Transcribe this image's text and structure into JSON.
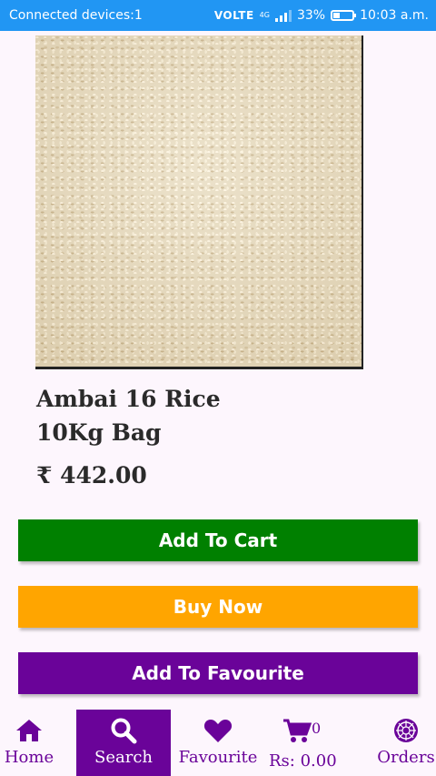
{
  "status_bar": {
    "left_text": "Connected devices:1",
    "network": "VOLTE",
    "network_type": "4G",
    "battery": "33%",
    "battery_level": 0.33,
    "time": "10:03 a.m."
  },
  "product": {
    "title_line1": "Ambai 16 Rice",
    "title_line2": "10Kg Bag",
    "currency_symbol": "₹",
    "price": "442.00"
  },
  "actions": {
    "add_to_cart": "Add To Cart",
    "buy_now": "Buy Now",
    "add_to_favourite": "Add To Favourite"
  },
  "bottom_nav": {
    "home": "Home",
    "search": "Search",
    "favourite": "Favourite",
    "cart_count": "0",
    "cart_total": "Rs: 0.00",
    "orders": "Orders"
  },
  "colors": {
    "status_bar": "#2196f3",
    "add_to_cart": "#008000",
    "buy_now": "#ffa500",
    "accent": "#6a0399"
  }
}
